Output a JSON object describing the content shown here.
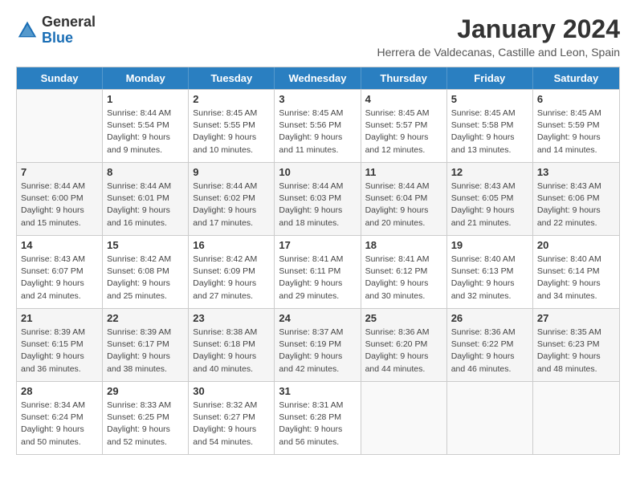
{
  "logo": {
    "general": "General",
    "blue": "Blue"
  },
  "title": "January 2024",
  "location": "Herrera de Valdecanas, Castille and Leon, Spain",
  "headers": [
    "Sunday",
    "Monday",
    "Tuesday",
    "Wednesday",
    "Thursday",
    "Friday",
    "Saturday"
  ],
  "weeks": [
    [
      {
        "day": "",
        "info": ""
      },
      {
        "day": "1",
        "info": "Sunrise: 8:44 AM\nSunset: 5:54 PM\nDaylight: 9 hours\nand 9 minutes."
      },
      {
        "day": "2",
        "info": "Sunrise: 8:45 AM\nSunset: 5:55 PM\nDaylight: 9 hours\nand 10 minutes."
      },
      {
        "day": "3",
        "info": "Sunrise: 8:45 AM\nSunset: 5:56 PM\nDaylight: 9 hours\nand 11 minutes."
      },
      {
        "day": "4",
        "info": "Sunrise: 8:45 AM\nSunset: 5:57 PM\nDaylight: 9 hours\nand 12 minutes."
      },
      {
        "day": "5",
        "info": "Sunrise: 8:45 AM\nSunset: 5:58 PM\nDaylight: 9 hours\nand 13 minutes."
      },
      {
        "day": "6",
        "info": "Sunrise: 8:45 AM\nSunset: 5:59 PM\nDaylight: 9 hours\nand 14 minutes."
      }
    ],
    [
      {
        "day": "7",
        "info": "Sunrise: 8:44 AM\nSunset: 6:00 PM\nDaylight: 9 hours\nand 15 minutes."
      },
      {
        "day": "8",
        "info": "Sunrise: 8:44 AM\nSunset: 6:01 PM\nDaylight: 9 hours\nand 16 minutes."
      },
      {
        "day": "9",
        "info": "Sunrise: 8:44 AM\nSunset: 6:02 PM\nDaylight: 9 hours\nand 17 minutes."
      },
      {
        "day": "10",
        "info": "Sunrise: 8:44 AM\nSunset: 6:03 PM\nDaylight: 9 hours\nand 18 minutes."
      },
      {
        "day": "11",
        "info": "Sunrise: 8:44 AM\nSunset: 6:04 PM\nDaylight: 9 hours\nand 20 minutes."
      },
      {
        "day": "12",
        "info": "Sunrise: 8:43 AM\nSunset: 6:05 PM\nDaylight: 9 hours\nand 21 minutes."
      },
      {
        "day": "13",
        "info": "Sunrise: 8:43 AM\nSunset: 6:06 PM\nDaylight: 9 hours\nand 22 minutes."
      }
    ],
    [
      {
        "day": "14",
        "info": "Sunrise: 8:43 AM\nSunset: 6:07 PM\nDaylight: 9 hours\nand 24 minutes."
      },
      {
        "day": "15",
        "info": "Sunrise: 8:42 AM\nSunset: 6:08 PM\nDaylight: 9 hours\nand 25 minutes."
      },
      {
        "day": "16",
        "info": "Sunrise: 8:42 AM\nSunset: 6:09 PM\nDaylight: 9 hours\nand 27 minutes."
      },
      {
        "day": "17",
        "info": "Sunrise: 8:41 AM\nSunset: 6:11 PM\nDaylight: 9 hours\nand 29 minutes."
      },
      {
        "day": "18",
        "info": "Sunrise: 8:41 AM\nSunset: 6:12 PM\nDaylight: 9 hours\nand 30 minutes."
      },
      {
        "day": "19",
        "info": "Sunrise: 8:40 AM\nSunset: 6:13 PM\nDaylight: 9 hours\nand 32 minutes."
      },
      {
        "day": "20",
        "info": "Sunrise: 8:40 AM\nSunset: 6:14 PM\nDaylight: 9 hours\nand 34 minutes."
      }
    ],
    [
      {
        "day": "21",
        "info": "Sunrise: 8:39 AM\nSunset: 6:15 PM\nDaylight: 9 hours\nand 36 minutes."
      },
      {
        "day": "22",
        "info": "Sunrise: 8:39 AM\nSunset: 6:17 PM\nDaylight: 9 hours\nand 38 minutes."
      },
      {
        "day": "23",
        "info": "Sunrise: 8:38 AM\nSunset: 6:18 PM\nDaylight: 9 hours\nand 40 minutes."
      },
      {
        "day": "24",
        "info": "Sunrise: 8:37 AM\nSunset: 6:19 PM\nDaylight: 9 hours\nand 42 minutes."
      },
      {
        "day": "25",
        "info": "Sunrise: 8:36 AM\nSunset: 6:20 PM\nDaylight: 9 hours\nand 44 minutes."
      },
      {
        "day": "26",
        "info": "Sunrise: 8:36 AM\nSunset: 6:22 PM\nDaylight: 9 hours\nand 46 minutes."
      },
      {
        "day": "27",
        "info": "Sunrise: 8:35 AM\nSunset: 6:23 PM\nDaylight: 9 hours\nand 48 minutes."
      }
    ],
    [
      {
        "day": "28",
        "info": "Sunrise: 8:34 AM\nSunset: 6:24 PM\nDaylight: 9 hours\nand 50 minutes."
      },
      {
        "day": "29",
        "info": "Sunrise: 8:33 AM\nSunset: 6:25 PM\nDaylight: 9 hours\nand 52 minutes."
      },
      {
        "day": "30",
        "info": "Sunrise: 8:32 AM\nSunset: 6:27 PM\nDaylight: 9 hours\nand 54 minutes."
      },
      {
        "day": "31",
        "info": "Sunrise: 8:31 AM\nSunset: 6:28 PM\nDaylight: 9 hours\nand 56 minutes."
      },
      {
        "day": "",
        "info": ""
      },
      {
        "day": "",
        "info": ""
      },
      {
        "day": "",
        "info": ""
      }
    ]
  ]
}
